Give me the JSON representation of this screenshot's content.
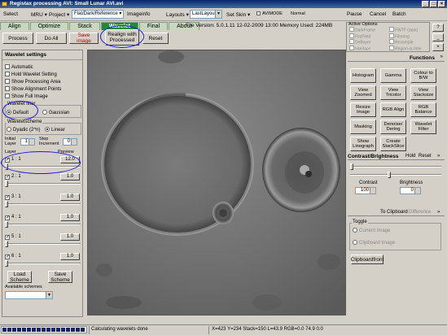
{
  "window": {
    "title": "Registax processing AVI: Small Lunar AVI.avi"
  },
  "menu": {
    "select": "Select",
    "mru": "MRU ▾",
    "project": "Project ▾",
    "flat_dark_combo": "Flat/Dark/Reference ▾",
    "imageinfo": "Imageinfo",
    "layouts": "Layouts ▾",
    "layout_combo": "LastLayout",
    "set_skin": "Set Skin ▾",
    "avimode_label": "AVIMODE",
    "avimode_value": "Normal",
    "pause": "Pause",
    "cancel": "Cancel",
    "batch": "Batch"
  },
  "tabs": [
    {
      "label": "Align",
      "active": false
    },
    {
      "label": "Optimize",
      "active": false
    },
    {
      "label": "Stack",
      "active": false
    },
    {
      "label": "Wavelet",
      "active": true
    },
    {
      "label": "Final",
      "active": false
    },
    {
      "label": "About",
      "active": false
    }
  ],
  "version_info": "File Version: 5.0.1.11     12-02-2009 13:00    Memory Used: 224MB",
  "toolbar": {
    "process": "Process",
    "do_all": "Do All",
    "save_image": "Save image",
    "realign": "Realign  with Processed",
    "reset": "Reset"
  },
  "active_options": {
    "header": "Active Options",
    "col1": [
      "DarkFrame",
      "FlatField",
      "DeBayer",
      "Interlace"
    ],
    "col2": [
      "FWTF (dark)",
      "Filtering",
      "Resample",
      "Region-in-Inter"
    ]
  },
  "wavelet": {
    "title": "Wavelet settings",
    "automatic": "Automatic",
    "hold": "Hold Wavelet Setting",
    "show_processing": "Show Processing Area",
    "show_alignment": "Show Alignment Points",
    "show_full": "Show Full Image",
    "filter_label": "Wavelet filter",
    "filter_default": "Default",
    "filter_gaussian": "Gaussian",
    "scheme_label": "Waveletscheme",
    "scheme_dyadic": "Dyadic (2^n)",
    "scheme_linear": "Linear",
    "initial_layer_label": "Initial Layer",
    "initial_layer_value": "1",
    "step_increment_label": "Step Increment",
    "step_increment_value": "0",
    "layer_header": "Layer",
    "preview_header": "Preview",
    "layers": [
      {
        "label": "1 : 1",
        "value": "12.0"
      },
      {
        "label": "2 : 1",
        "value": "1.0"
      },
      {
        "label": "3 : 1",
        "value": "1.0"
      },
      {
        "label": "4 : 1",
        "value": "1.0"
      },
      {
        "label": "5 : 1",
        "value": "1.0"
      },
      {
        "label": "6 : 1",
        "value": "1.0"
      }
    ],
    "load_scheme": "Load Scheme",
    "save_scheme": "Save Scheme",
    "available_schemes": "Available schemes"
  },
  "functions": {
    "title": "Functions",
    "buttons": [
      "Histogram",
      "Gamma",
      "Colour to B/W",
      "View Zoomed",
      "View Tricolor",
      "View Stacksize",
      "Resize Image",
      "RGB Align",
      "RGB Balance",
      "Masking",
      "Denoise/ Dering",
      "Wavelet Filter",
      "Show Linegraph",
      "Create StackSlice"
    ]
  },
  "contrast": {
    "title": "Contrast/Brightness",
    "hold": "Hold",
    "reset": "Reset",
    "contrast_label": "Contrast",
    "contrast_value": "100",
    "brightness_label": "Brightness",
    "brightness_value": "0"
  },
  "clipboard": {
    "to_clipboard": "To Clipboard",
    "difference": "Difference",
    "toggle_label": "Toggle",
    "current_image": "Current Image",
    "clipboard_image": "Clipboard Image",
    "clipboard_front": "Clipboardfront"
  },
  "status": {
    "message": "Calculating wavelets done",
    "coords": "X=423 Y=234 Stack=150 L=43.9 RGB=0.0 74.9 0.0"
  }
}
